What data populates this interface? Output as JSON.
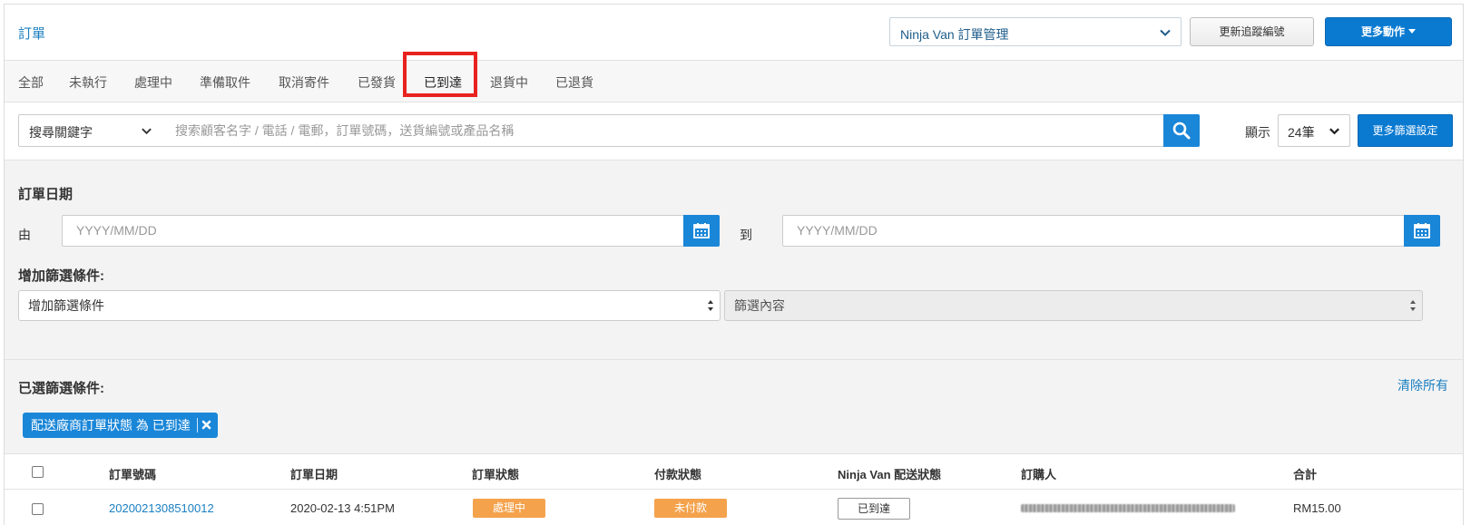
{
  "header": {
    "title": "訂單",
    "management_select": "Ninja Van 訂單管理",
    "update_tracking_button": "更新追蹤編號",
    "more_actions_button": "更多動作"
  },
  "tabs": [
    {
      "label": "全部"
    },
    {
      "label": "未執行"
    },
    {
      "label": "處理中"
    },
    {
      "label": "準備取件"
    },
    {
      "label": "取消寄件"
    },
    {
      "label": "已發貨"
    },
    {
      "label": "已到達",
      "active": true
    },
    {
      "label": "退貨中"
    },
    {
      "label": "已退貨"
    }
  ],
  "search": {
    "keyword_select": "搜尋關鍵字",
    "placeholder": "搜索顧客名字 / 電話 / 電郵，訂單號碼，送貨編號或產品名稱",
    "show_label": "顯示",
    "count_select": "24筆",
    "more_filter_button": "更多篩選設定"
  },
  "order_date": {
    "title": "訂單日期",
    "from_label": "由",
    "to_label": "到",
    "from_placeholder": "YYYY/MM/DD",
    "to_placeholder": "YYYY/MM/DD"
  },
  "add_filter": {
    "title": "增加篩選條件:",
    "condition_select": "增加篩選條件",
    "content_select": "篩選內容"
  },
  "selected_filters": {
    "title": "已選篩選條件:",
    "clear_all": "清除所有",
    "chip": "配送廠商訂單狀態 為 已到達"
  },
  "table": {
    "headers": {
      "order_no": "訂單號碼",
      "order_date": "訂單日期",
      "order_status": "訂單狀態",
      "payment_status": "付款狀態",
      "delivery_status": "Ninja Van 配送狀態",
      "buyer": "訂購人",
      "total": "合計"
    },
    "rows": [
      {
        "order_no": "20200213085100​12",
        "order_date": "2020-02-13 4:51PM",
        "order_status": "處理中",
        "payment_status": "未付款",
        "delivery_status": "已到達",
        "total": "RM15.00"
      }
    ]
  },
  "colors": {
    "primary": "#0a7ad1",
    "link": "#1a7fc1",
    "badge_orange": "#f4a24c",
    "highlight_red": "#e8221f"
  }
}
